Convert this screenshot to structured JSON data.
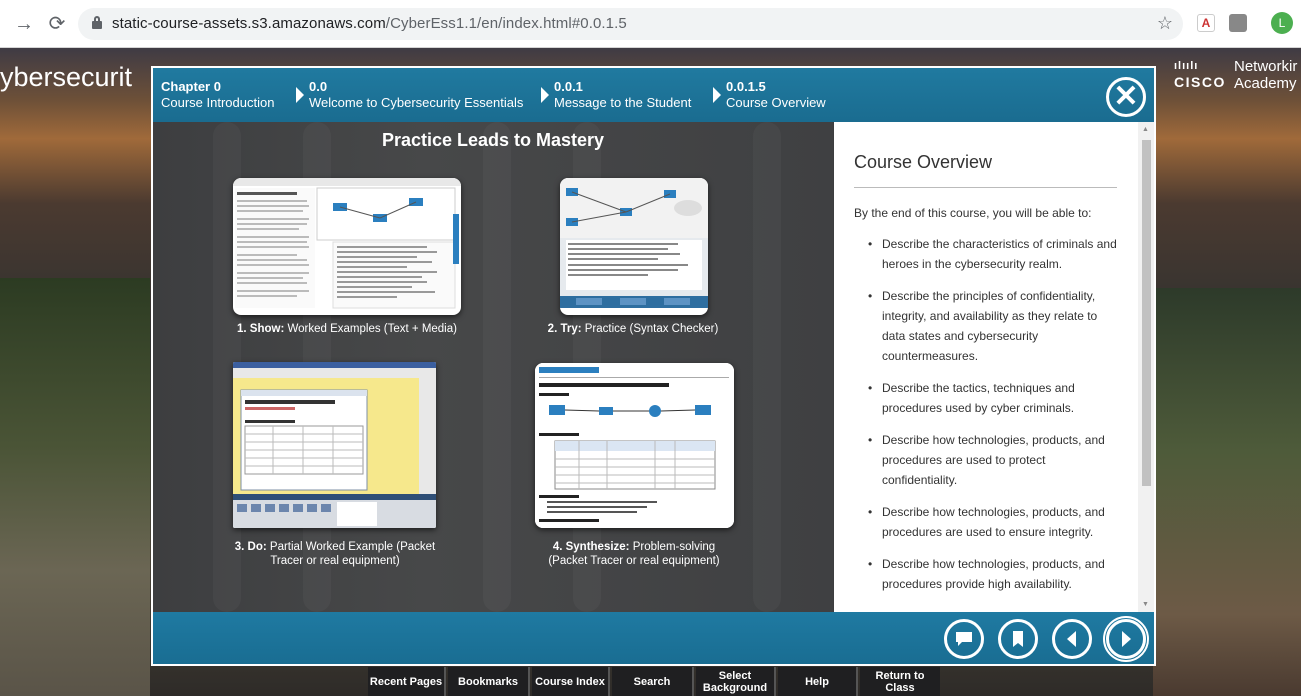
{
  "browser": {
    "url_host": "static-course-assets.s3.amazonaws.com",
    "url_path": "/CyberEss1.1/en/index.html#0.0.1.5",
    "profile_initial": "L",
    "icons": [
      "back-arrow-icon",
      "reload-icon",
      "lock-icon",
      "star-icon",
      "pdf-icon",
      "extension-icon"
    ]
  },
  "page": {
    "site_title": "ybersecurit",
    "logo": {
      "bars": "ılıılı",
      "brand": "CISCO",
      "line1": "Networkir",
      "line2": "Academy"
    }
  },
  "breadcrumb": [
    {
      "num": "Chapter 0",
      "label": "Course Introduction"
    },
    {
      "num": "0.0",
      "label": "Welcome to Cybersecurity Essentials"
    },
    {
      "num": "0.0.1",
      "label": "Message to the Student"
    },
    {
      "num": "0.0.1.5",
      "label": "Course Overview"
    }
  ],
  "content": {
    "title": "Practice Leads to Mastery",
    "cards": [
      {
        "bold": "1. Show:",
        "text": " Worked Examples (Text + Media)"
      },
      {
        "bold": "2. Try:",
        "text": " Practice (Syntax Checker)"
      },
      {
        "bold": "3. Do:",
        "text": " Partial Worked Example (Packet",
        "line2": "Tracer or real equipment)"
      },
      {
        "bold": "4. Synthesize:",
        "text": " Problem-solving",
        "line2": "(Packet Tracer or real equipment)"
      }
    ]
  },
  "panel": {
    "title": "Course Overview",
    "intro": "By the end of this course, you will be able to:",
    "objectives": [
      "Describe the characteristics of criminals and heroes in the cybersecurity realm.",
      "Describe the principles of confidentiality, integrity, and availability as they relate to data states and cybersecurity countermeasures.",
      "Describe the tactics, techniques and procedures used by cyber criminals.",
      "Describe how technologies, products, and procedures are used to protect confidentiality.",
      "Describe how technologies, products, and procedures are used to ensure integrity.",
      "Describe how technologies, products, and procedures provide high availability."
    ]
  },
  "footer": {
    "buttons": [
      "chat-icon",
      "bookmark-icon",
      "previous-icon",
      "next-icon"
    ]
  },
  "menu": [
    {
      "label": "Recent Pages"
    },
    {
      "label": "Bookmarks"
    },
    {
      "label": "Course Index"
    },
    {
      "label": "Search"
    },
    {
      "label": "Select Background"
    },
    {
      "label": "Help"
    },
    {
      "label": "Return to Class"
    }
  ],
  "colors": {
    "accent": "#1f7aa2",
    "dot": "#27a7d8"
  }
}
